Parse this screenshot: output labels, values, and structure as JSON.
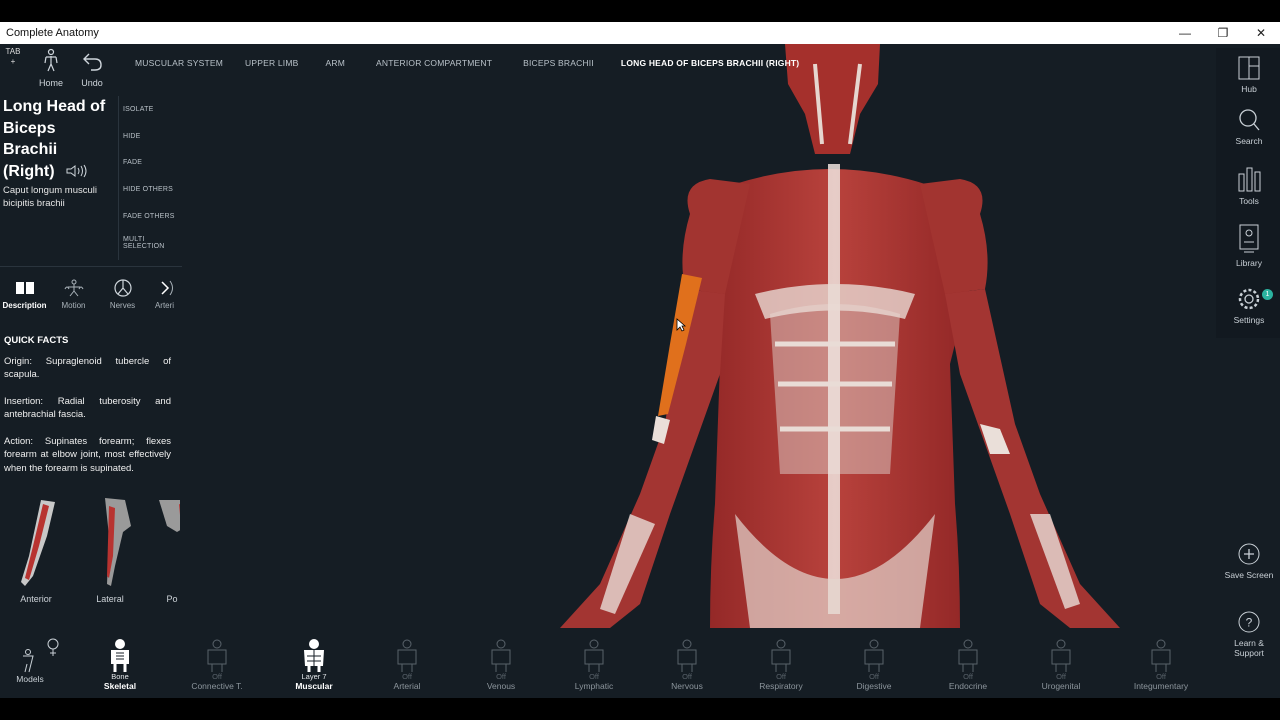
{
  "window": {
    "title": "Complete Anatomy",
    "minimize_icon": "minimize-icon",
    "restore_icon": "restore-icon",
    "close_icon": "close-icon"
  },
  "toolbar": {
    "tab_label": "TAB",
    "tab_plus": "+",
    "home_label": "Home",
    "undo_label": "Undo"
  },
  "breadcrumb": [
    "MUSCULAR SYSTEM",
    "UPPER LIMB",
    "ARM",
    "ANTERIOR COMPARTMENT",
    "BICEPS BRACHII",
    "LONG HEAD OF BICEPS BRACHII (RIGHT)"
  ],
  "structure": {
    "title_lines": [
      "Long Head of",
      "Biceps",
      "Brachii",
      "(Right)"
    ],
    "latin_name": "Caput longum musculi bicipitis brachii"
  },
  "actions": [
    "ISOLATE",
    "HIDE",
    "FADE",
    "HIDE OTHERS",
    "FADE OTHERS",
    "MULTI SELECTION"
  ],
  "info_tabs": [
    {
      "label": "Description",
      "icon": "book-icon",
      "active": true
    },
    {
      "label": "Motion",
      "icon": "motion-icon",
      "active": false
    },
    {
      "label": "Nerves",
      "icon": "nerve-icon",
      "active": false
    },
    {
      "label": "Arteri",
      "icon": "chevron-right-icon",
      "active": false
    }
  ],
  "quick_facts": {
    "heading": "QUICK FACTS",
    "origin": "Origin: Supraglenoid tubercle of scapula.",
    "insertion": "Insertion: Radial tuberosity and antebrachial fascia.",
    "action": "Action: Supinates forearm; flexes forearm at elbow joint, most effectively when the forearm is supinated."
  },
  "views": [
    "Anterior",
    "Lateral",
    "Po"
  ],
  "right_sidebar": {
    "hub": "Hub",
    "search": "Search",
    "tools": "Tools",
    "library": "Library",
    "settings": "Settings",
    "settings_badge": "1",
    "save_screen": "Save Screen",
    "learn_support": "Learn & Support"
  },
  "systems": {
    "models": "Models",
    "items": [
      {
        "state": "Bone",
        "name": "Skeletal",
        "on": true
      },
      {
        "state": "Off",
        "name": "Connective T.",
        "on": false
      },
      {
        "state": "Layer 7",
        "name": "Muscular",
        "on": true
      },
      {
        "state": "Off",
        "name": "Arterial",
        "on": false
      },
      {
        "state": "Off",
        "name": "Venous",
        "on": false
      },
      {
        "state": "Off",
        "name": "Lymphatic",
        "on": false
      },
      {
        "state": "Off",
        "name": "Nervous",
        "on": false
      },
      {
        "state": "Off",
        "name": "Respiratory",
        "on": false
      },
      {
        "state": "Off",
        "name": "Digestive",
        "on": false
      },
      {
        "state": "Off",
        "name": "Endocrine",
        "on": false
      },
      {
        "state": "Off",
        "name": "Urogenital",
        "on": false
      },
      {
        "state": "Off",
        "name": "Integumentary",
        "on": false
      }
    ]
  },
  "colors": {
    "background": "#151d24",
    "muscle": "#a8302e",
    "selected_muscle": "#e0701c",
    "tendon": "#e8ddd6",
    "accent_badge": "#2bb3a0"
  }
}
